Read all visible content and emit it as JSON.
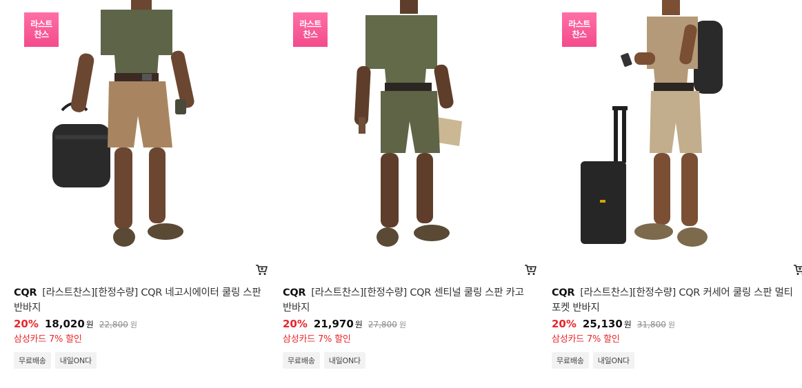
{
  "products": [
    {
      "badge_line1": "라스트",
      "badge_line2": "찬스",
      "brand": "CQR",
      "name": "[라스트찬스][한정수량] CQR 네고시에이터 쿨링 스판 반바지",
      "discount": "20%",
      "price": "18,020",
      "currency": "원",
      "original_price": "22,800",
      "original_currency": "원",
      "card_discount": "삼성카드 7% 할인",
      "tags": [
        "무료배송",
        "내일ON다"
      ],
      "cart_icon": "cart-icon",
      "shirt_color": "#5d6448",
      "shorts_color": "#a88560"
    },
    {
      "badge_line1": "라스트",
      "badge_line2": "찬스",
      "brand": "CQR",
      "name": "[라스트찬스][한정수량] CQR 센티널 쿨링 스판 카고 반바지",
      "discount": "20%",
      "price": "21,970",
      "currency": "원",
      "original_price": "27,800",
      "original_currency": "원",
      "card_discount": "삼성카드 7% 할인",
      "tags": [
        "무료배송",
        "내일ON다"
      ],
      "cart_icon": "cart-icon",
      "shirt_color": "#626a4a",
      "shorts_color": "#5f6446"
    },
    {
      "badge_line1": "라스트",
      "badge_line2": "찬스",
      "brand": "CQR",
      "name": "[라스트찬스][한정수량] CQR 커세어 쿨링 스판 멀티포켓 반바지",
      "discount": "20%",
      "price": "25,130",
      "currency": "원",
      "original_price": "31,800",
      "original_currency": "원",
      "card_discount": "삼성카드 7% 할인",
      "tags": [
        "무료배송",
        "내일ON다"
      ],
      "cart_icon": "cart-icon",
      "shirt_color": "#b49a78",
      "shorts_color": "#c2ad8c"
    }
  ]
}
